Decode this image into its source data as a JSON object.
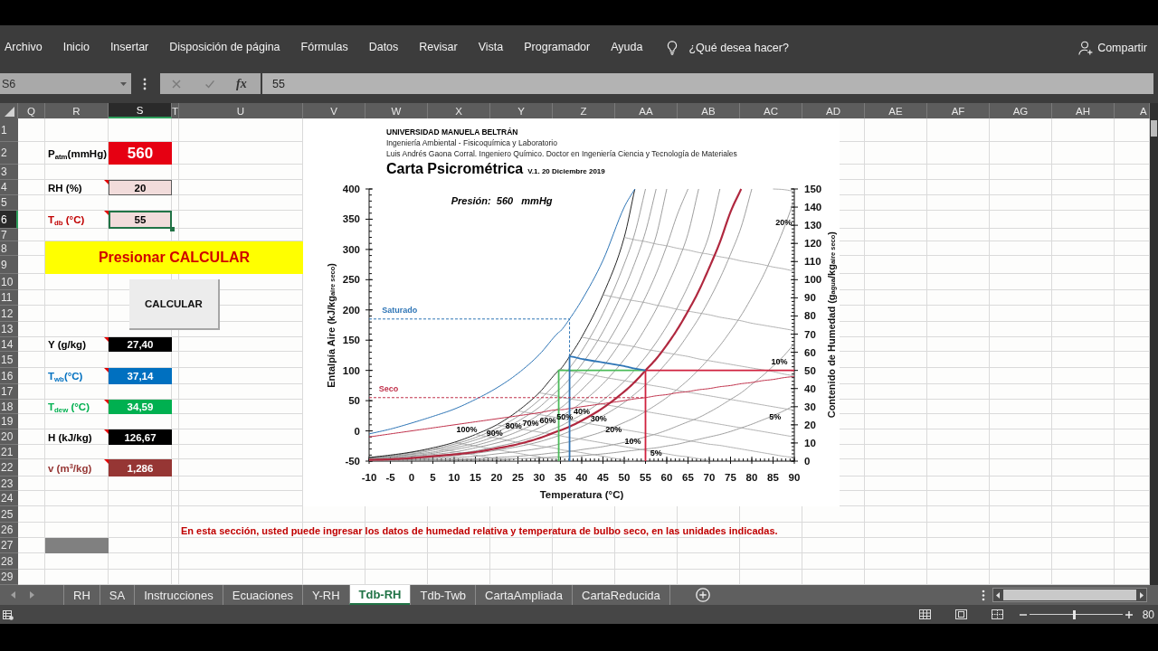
{
  "ribbon": {
    "tabs": [
      {
        "label": "Archivo",
        "selected": false
      },
      {
        "label": "Inicio",
        "selected": false
      },
      {
        "label": "Insertar",
        "selected": false
      },
      {
        "label": "Disposición de página",
        "selected": false
      },
      {
        "label": "Fórmulas",
        "selected": false
      },
      {
        "label": "Datos",
        "selected": false
      },
      {
        "label": "Revisar",
        "selected": false
      },
      {
        "label": "Vista",
        "selected": false
      },
      {
        "label": "Programador",
        "selected": false
      },
      {
        "label": "Ayuda",
        "selected": false
      }
    ],
    "tell_me": "¿Qué desea hacer?",
    "share": "Compartir"
  },
  "formula_bar": {
    "name_box": "S6",
    "function_label": "fx",
    "formula": "55"
  },
  "sheet": {
    "columns": [
      {
        "label": "Q",
        "selected": false
      },
      {
        "label": "R",
        "selected": false
      },
      {
        "label": "S",
        "selected": true
      },
      {
        "label": "T",
        "selected": false
      },
      {
        "label": "U",
        "selected": false
      },
      {
        "label": "V",
        "selected": false
      },
      {
        "label": "W",
        "selected": false
      },
      {
        "label": "X",
        "selected": false
      },
      {
        "label": "Y",
        "selected": false
      },
      {
        "label": "Z",
        "selected": false
      },
      {
        "label": "AA",
        "selected": false
      },
      {
        "label": "AB",
        "selected": false
      },
      {
        "label": "AC",
        "selected": false
      },
      {
        "label": "AD",
        "selected": false
      },
      {
        "label": "AE",
        "selected": false
      },
      {
        "label": "AF",
        "selected": false
      },
      {
        "label": "AG",
        "selected": false
      },
      {
        "label": "AH",
        "selected": false
      },
      {
        "label": "A",
        "selected": false
      }
    ],
    "rows": [
      {
        "label": "1",
        "selected": false
      },
      {
        "label": "2",
        "selected": false
      },
      {
        "label": "3",
        "selected": false
      },
      {
        "label": "4",
        "selected": false
      },
      {
        "label": "5",
        "selected": false
      },
      {
        "label": "6",
        "selected": true
      },
      {
        "label": "7",
        "selected": false
      },
      {
        "label": "8",
        "selected": false
      },
      {
        "label": "9",
        "selected": false
      },
      {
        "label": "10",
        "selected": false
      },
      {
        "label": "11",
        "selected": false
      },
      {
        "label": "12",
        "selected": false
      },
      {
        "label": "13",
        "selected": false
      },
      {
        "label": "14",
        "selected": false
      },
      {
        "label": "15",
        "selected": false
      },
      {
        "label": "16",
        "selected": false
      },
      {
        "label": "17",
        "selected": false
      },
      {
        "label": "18",
        "selected": false
      },
      {
        "label": "19",
        "selected": false
      },
      {
        "label": "20",
        "selected": false
      },
      {
        "label": "21",
        "selected": false
      },
      {
        "label": "22",
        "selected": false
      },
      {
        "label": "23",
        "selected": false
      },
      {
        "label": "24",
        "selected": false
      },
      {
        "label": "25",
        "selected": false
      },
      {
        "label": "26",
        "selected": false
      },
      {
        "label": "27",
        "selected": false
      },
      {
        "label": "28",
        "selected": false
      },
      {
        "label": "29",
        "selected": false
      }
    ],
    "parameters": [
      {
        "kind": "display",
        "label": "P$_{atm}$(mmHg)",
        "color": "#000000",
        "value": {
          "text": "560",
          "color": "#e60012"
        },
        "comment": false,
        "selected": false
      },
      {
        "kind": "input",
        "label": "RH (%)",
        "color": "#000000",
        "value": {
          "text": "20",
          "color": "#f2dcdb"
        },
        "comment": true,
        "selected": false
      },
      {
        "kind": "input",
        "label": "T$_{db}$ (°C)",
        "color": "#c00000",
        "value": {
          "text": "55",
          "color": "#f2dcdb"
        },
        "comment": true,
        "selected": true
      }
    ],
    "banner": "Presionar CALCULAR",
    "button": "CALCULAR",
    "results": [
      {
        "label": "Y (g/kg)",
        "color": "#000000",
        "value": {
          "text": "27,40",
          "color": "#000000"
        },
        "comment": true,
        "selected": false
      },
      {
        "label": "T$_{wb}$(°C)",
        "color": "#0070c0",
        "value": {
          "text": "37,14",
          "color": "#0070c0"
        },
        "comment": true,
        "selected": false
      },
      {
        "label": "T$_{dew}$ (°C)",
        "color": "#00b050",
        "value": {
          "text": "34,59",
          "color": "#00b050"
        },
        "comment": true,
        "selected": false
      },
      {
        "label": "H (kJ/kg)",
        "color": "#000000",
        "value": {
          "text": "126,67",
          "color": "#000000"
        },
        "comment": true,
        "selected": false
      },
      {
        "label": "v (m$^{3}$/kg)",
        "color": "#963634",
        "value": {
          "text": "1,286",
          "color": "#963634"
        },
        "comment": true,
        "selected": false
      }
    ],
    "note": "En esta sección, usted puede ingresar los datos de humedad relativa y temperatura de bulbo seco, en las unidades indicadas."
  },
  "chart": {
    "header": [
      "UNIVERSIDAD MANUELA BELTRÁN",
      "Ingeniería Ambiental - Fisicoquímica y Laboratorio",
      "Luis Andrés Gaona Corral. Ingeniero Químico. Doctor en Ingeniería Ciencia y Tecnología de Materiales"
    ],
    "version": "V.1. 20 Diciembre 2019",
    "chart_data": {
      "type": "line",
      "title": "Carta Psicrométrica",
      "xlabel": "Temperatura (°C)",
      "ylabel": "Entalpía Aire (kJ/kg$_{aire seco}$)",
      "y2label": "Contenido de Humedad (g$_{agua}$/kg$_{aire seco}$)",
      "xlim": [
        -10,
        90
      ],
      "ylim": [
        -50,
        400
      ],
      "y2lim": [
        0,
        150
      ],
      "xticks": [
        -10,
        -5,
        0,
        5,
        10,
        15,
        20,
        25,
        30,
        35,
        40,
        45,
        50,
        55,
        60,
        65,
        70,
        75,
        80,
        85,
        90
      ],
      "yticks": [
        -50,
        0,
        50,
        100,
        150,
        200,
        250,
        300,
        350,
        400
      ],
      "y2ticks": [
        0,
        10,
        20,
        30,
        40,
        50,
        60,
        70,
        80,
        90,
        100,
        110,
        120,
        130,
        140,
        150
      ],
      "x": [
        -10,
        -5,
        0,
        5,
        10,
        15,
        20,
        25,
        30,
        34.59,
        34.59,
        35,
        37.14,
        37.14,
        40,
        45,
        50,
        52.5,
        55,
        55,
        57.5,
        60,
        62.5,
        65,
        67.5,
        70,
        72.5,
        75,
        77.5,
        80,
        82.5,
        85,
        87.5,
        90
      ],
      "series": [
        {
          "color": "#8c8c8c",
          "values": [
            -44,
            -41,
            -36,
            -30,
            -22,
            -11,
            4,
            24,
            51,
            83,
            83,
            86,
            104,
            104,
            132,
            194,
            276,
            327,
            400,
            400,
            null,
            null,
            null,
            null,
            null,
            null,
            null,
            null,
            null,
            null,
            null,
            null,
            null,
            null
          ]
        },
        {
          "color": "#8c8c8c",
          "values": [
            -45,
            -42,
            -38,
            -32,
            -25,
            -15,
            -2,
            16,
            39,
            68,
            68,
            70,
            86,
            86,
            110,
            164,
            235,
            278,
            329,
            329,
            400,
            null,
            null,
            null,
            null,
            null,
            null,
            null,
            null,
            null,
            null,
            null,
            null,
            null
          ]
        },
        {
          "color": "#8c8c8c",
          "values": [
            -45,
            -43,
            -39,
            -35,
            -28,
            -20,
            -8,
            7,
            27,
            52,
            52,
            54,
            68,
            68,
            89,
            134,
            194,
            231,
            274,
            274,
            322,
            400,
            null,
            null,
            null,
            null,
            null,
            null,
            null,
            null,
            null,
            null,
            null,
            null
          ]
        },
        {
          "color": "#8c8c8c",
          "values": [
            -46,
            -44,
            -41,
            -37,
            -31,
            -24,
            -14,
            -1,
            16,
            37,
            37,
            38,
            50,
            50,
            68,
            106,
            156,
            186,
            221,
            221,
            260,
            306,
            358,
            400,
            null,
            null,
            null,
            null,
            null,
            null,
            null,
            null,
            null,
            null
          ]
        },
        {
          "color": "#8c8c8c",
          "values": [
            -47,
            -45,
            -42,
            -39,
            -35,
            -28,
            -20,
            -10,
            5,
            22,
            22,
            23,
            33,
            33,
            47,
            78,
            118,
            142,
            170,
            170,
            201,
            238,
            278,
            326,
            400,
            null,
            null,
            null,
            null,
            null,
            null,
            null,
            null,
            null
          ]
        },
        {
          "color": "#8c8c8c",
          "values": [
            -47,
            -46,
            -44,
            -41,
            -38,
            -33,
            -26,
            -18,
            -7,
            7,
            7,
            8,
            16,
            16,
            27,
            51,
            82,
            101,
            122,
            122,
            146,
            173,
            204,
            239,
            279,
            325,
            400,
            null,
            null,
            null,
            null,
            null,
            null,
            null
          ]
        },
        {
          "color": "#8c8c8c",
          "values": [
            -48,
            -47,
            -45,
            -44,
            -41,
            -37,
            -32,
            -26,
            -18,
            -8,
            -8,
            -7,
            -1,
            -1,
            7,
            25,
            47,
            61,
            76,
            76,
            93,
            113,
            134,
            159,
            186,
            217,
            252,
            292,
            337,
            400,
            null,
            null,
            null,
            null
          ]
        },
        {
          "color": "#8c8c8c",
          "values": [
            -49,
            -48,
            -47,
            -46,
            -44,
            -42,
            -38,
            -34,
            -29,
            -22,
            -22,
            -21,
            -18,
            -18,
            -12,
            -1,
            14,
            22,
            32,
            32,
            43,
            55,
            69,
            84,
            101,
            120,
            141,
            165,
            191,
            221,
            254,
            292,
            334,
            382
          ]
        },
        {
          "color": "#8c8c8c",
          "values": [
            -49,
            -49,
            -48,
            -48,
            -47,
            -46,
            -44,
            -42,
            -39,
            -36,
            -36,
            -36,
            -34,
            -34,
            -31,
            -26,
            -19,
            -15,
            -10,
            -10,
            -5,
            1,
            8,
            15,
            22,
            31,
            41,
            52,
            63,
            77,
            91,
            107,
            124,
            144
          ]
        },
        {
          "color": "#8c8c8c",
          "values": [
            -49,
            -49,
            -49,
            -49,
            -48,
            -48,
            -47,
            -46,
            -45,
            -43,
            -43,
            -43,
            -42,
            -42,
            -41,
            -38,
            -34,
            -32,
            -30,
            -30,
            -28,
            -25,
            -22,
            -18,
            -14,
            -10,
            -6,
            -1,
            5,
            11,
            18,
            25,
            33,
            42
          ]
        },
        {
          "color": "#000000",
          "values": [
            -44,
            -40,
            -35,
            -28,
            -19,
            -6,
            10,
            33,
            63,
            100,
            100,
            102,
            123,
            123,
            155,
            225,
            320,
            400,
            null,
            null,
            null,
            null,
            null,
            null,
            null,
            null,
            null,
            null,
            null,
            null,
            null,
            null,
            null,
            null
          ]
        },
        {
          "color": "#a3a3a3",
          "values": [
            null,
            null,
            null,
            -28,
            -34,
            -40,
            -46,
            -50,
            null,
            null,
            null,
            null,
            null,
            null,
            null,
            null,
            null,
            null,
            null,
            null,
            null,
            null,
            null,
            null,
            null,
            null,
            null,
            null,
            null,
            null,
            null,
            null,
            null,
            null
          ]
        },
        {
          "color": "#a3a3a3",
          "values": [
            null,
            null,
            null,
            null,
            -19,
            -25,
            -31,
            -37,
            -43,
            -48,
            -48,
            -49,
            -50,
            -50,
            null,
            null,
            null,
            null,
            null,
            null,
            null,
            null,
            null,
            null,
            null,
            null,
            null,
            null,
            null,
            null,
            null,
            null,
            null,
            null
          ]
        },
        {
          "color": "#a3a3a3",
          "values": [
            null,
            null,
            null,
            null,
            null,
            -6,
            -12,
            -19,
            -25,
            -30,
            -30,
            -31,
            -33,
            -33,
            -36,
            -42,
            -48,
            -50,
            null,
            null,
            null,
            null,
            null,
            null,
            null,
            null,
            null,
            null,
            null,
            null,
            null,
            null,
            null,
            null
          ]
        },
        {
          "color": "#a3a3a3",
          "values": [
            null,
            null,
            null,
            null,
            null,
            null,
            10,
            4,
            -2,
            -7,
            -7,
            -8,
            -11,
            -11,
            -14,
            -20,
            -26,
            -29,
            -32,
            -32,
            -35,
            -38,
            -41,
            -43,
            -46,
            -49,
            null,
            null,
            null,
            null,
            null,
            null,
            null,
            null
          ]
        },
        {
          "color": "#a3a3a3",
          "values": [
            null,
            null,
            null,
            null,
            null,
            null,
            null,
            33,
            27,
            21,
            21,
            20,
            18,
            18,
            14,
            8,
            2,
            -1,
            -4,
            -4,
            -7,
            -10,
            -13,
            -16,
            -19,
            -22,
            -24,
            -27,
            -30,
            -33,
            -36,
            -39,
            -42,
            -44
          ]
        },
        {
          "color": "#a3a3a3",
          "values": [
            null,
            null,
            null,
            null,
            null,
            null,
            null,
            null,
            63,
            57,
            57,
            56,
            53,
            53,
            50,
            44,
            38,
            35,
            32,
            32,
            29,
            26,
            23,
            20,
            17,
            14,
            11,
            8,
            5,
            2,
            -1,
            -4,
            -7,
            -10
          ]
        },
        {
          "color": "#a3a3a3",
          "values": [
            null,
            null,
            null,
            null,
            null,
            null,
            null,
            null,
            null,
            null,
            null,
            102,
            99,
            99,
            96,
            89,
            83,
            80,
            77,
            77,
            74,
            71,
            67,
            64,
            61,
            58,
            55,
            52,
            49,
            46,
            43,
            40,
            37,
            34
          ]
        },
        {
          "color": "#a3a3a3",
          "values": [
            null,
            null,
            null,
            null,
            null,
            null,
            null,
            null,
            null,
            null,
            null,
            null,
            null,
            null,
            155,
            148,
            142,
            139,
            135,
            135,
            132,
            129,
            126,
            123,
            119,
            116,
            113,
            110,
            107,
            104,
            101,
            98,
            94,
            91
          ]
        },
        {
          "color": "#a3a3a3",
          "values": [
            null,
            null,
            null,
            null,
            null,
            null,
            null,
            null,
            null,
            null,
            null,
            null,
            null,
            null,
            null,
            225,
            218,
            215,
            212,
            212,
            208,
            205,
            201,
            198,
            195,
            192,
            188,
            185,
            182,
            178,
            175,
            172,
            169,
            166
          ]
        },
        {
          "color": "#a3a3a3",
          "values": [
            null,
            null,
            null,
            null,
            null,
            null,
            null,
            null,
            null,
            null,
            null,
            null,
            null,
            null,
            null,
            null,
            320,
            316,
            313,
            313,
            309,
            306,
            302,
            299,
            295,
            292,
            288,
            285,
            281,
            278,
            275,
            271,
            268,
            264
          ]
        },
        {
          "color": "#a3a3a3",
          "values": [
            null,
            null,
            null,
            null,
            null,
            null,
            null,
            null,
            null,
            null,
            null,
            null,
            null,
            null,
            null,
            null,
            null,
            null,
            null,
            null,
            null,
            null,
            null,
            null,
            null,
            null,
            null,
            null,
            null,
            null,
            null,
            400,
            399,
            396
          ]
        },
        {
          "color": "#2e75b6",
          "values": [
            -5,
            3,
            13,
            24,
            36,
            52,
            71,
            95,
            126,
            163,
            163,
            165,
            185,
            185,
            216,
            282,
            370,
            400,
            null,
            null,
            null,
            null,
            null,
            null,
            null,
            null,
            null,
            null,
            null,
            null,
            null,
            null,
            null,
            null
          ]
        },
        {
          "color": "#c0304a",
          "values": [
            -10,
            -5,
            0,
            5,
            10,
            15,
            20,
            25,
            30,
            35,
            35,
            35,
            37,
            37,
            40,
            45,
            50,
            53,
            55,
            55,
            58,
            60,
            63,
            65,
            68,
            70,
            73,
            75,
            78,
            80,
            83,
            85,
            88,
            90
          ]
        },
        {
          "color": "#b0283f",
          "values": [
            -48,
            -47,
            -45,
            -42,
            -39,
            -35,
            -29,
            -22,
            -12,
            0,
            0,
            1,
            7,
            7,
            17,
            38,
            65,
            81,
            100,
            100,
            119,
            142,
            168,
            198,
            231,
            270,
            312,
            362,
            400,
            null,
            null,
            null,
            null,
            null
          ]
        },
        {
          "color": "#4cbb5a",
          "values": [
            null,
            null,
            null,
            null,
            null,
            null,
            null,
            null,
            null,
            -50,
            100,
            100,
            100,
            100,
            100,
            100,
            100,
            100,
            100,
            null,
            null,
            null,
            null,
            null,
            null,
            null,
            null,
            null,
            null,
            null,
            null,
            null,
            null,
            null
          ]
        },
        {
          "color": "#d0213e",
          "values": [
            null,
            null,
            null,
            null,
            null,
            null,
            null,
            null,
            null,
            null,
            null,
            null,
            null,
            null,
            null,
            null,
            null,
            null,
            -50,
            100,
            100,
            100,
            100,
            100,
            100,
            100,
            100,
            100,
            100,
            100,
            100,
            100,
            100,
            100
          ]
        },
        {
          "color": "#2e75b6",
          "values": [
            null,
            null,
            null,
            null,
            null,
            null,
            null,
            null,
            null,
            null,
            null,
            null,
            -50,
            123,
            119,
            113,
            107,
            103,
            100,
            null,
            null,
            null,
            null,
            null,
            null,
            null,
            null,
            null,
            null,
            null,
            null,
            null,
            null,
            null
          ]
        },
        {
          "color": "#2e75b6",
          "line_style": "dashed",
          "values": [
            185,
            185,
            185,
            185,
            185,
            185,
            185,
            185,
            185,
            185,
            185,
            185,
            185,
            123,
            null,
            null,
            null,
            null,
            null,
            null,
            null,
            null,
            null,
            null,
            null,
            null,
            null,
            null,
            null,
            null,
            null,
            null,
            null,
            null
          ]
        },
        {
          "color": "#c0304a",
          "line_style": "dashed",
          "values": [
            55,
            55,
            55,
            55,
            55,
            55,
            55,
            55,
            55,
            55,
            55,
            55,
            55,
            55,
            55,
            55,
            55,
            55,
            55,
            null,
            null,
            null,
            null,
            null,
            null,
            null,
            null,
            null,
            null,
            null,
            null,
            null,
            null,
            null
          ]
        }
      ],
      "annotations": [
        "Presión:  560   mmHg",
        "Saturado",
        "Seco",
        "20%",
        "10%",
        "5%",
        "100%",
        "90%",
        "80%",
        "70%",
        "60%",
        "50%",
        "40%",
        "30%",
        "20%",
        "10%",
        "5%"
      ]
    }
  },
  "sheet_tabs": [
    {
      "label": "RH",
      "selected": false
    },
    {
      "label": "SA",
      "selected": false
    },
    {
      "label": "Instrucciones",
      "selected": false
    },
    {
      "label": "Ecuaciones",
      "selected": false
    },
    {
      "label": "Y-RH",
      "selected": false
    },
    {
      "label": "Tdb-RH",
      "selected": true
    },
    {
      "label": "Tdb-Twb",
      "selected": false
    },
    {
      "label": "CartaAmpliada",
      "selected": false
    },
    {
      "label": "CartaReducida",
      "selected": false
    }
  ],
  "status_bar": {
    "zoom": {
      "level": 0.48
    },
    "zoom_label": "80"
  }
}
